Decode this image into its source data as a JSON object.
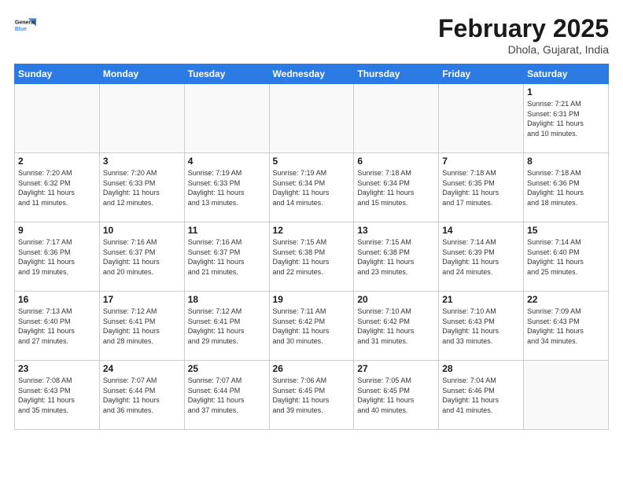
{
  "header": {
    "logo_line1": "General",
    "logo_line2": "Blue",
    "title": "February 2025",
    "subtitle": "Dhola, Gujarat, India"
  },
  "weekdays": [
    "Sunday",
    "Monday",
    "Tuesday",
    "Wednesday",
    "Thursday",
    "Friday",
    "Saturday"
  ],
  "weeks": [
    [
      {
        "num": "",
        "text": ""
      },
      {
        "num": "",
        "text": ""
      },
      {
        "num": "",
        "text": ""
      },
      {
        "num": "",
        "text": ""
      },
      {
        "num": "",
        "text": ""
      },
      {
        "num": "",
        "text": ""
      },
      {
        "num": "1",
        "text": "Sunrise: 7:21 AM\nSunset: 6:31 PM\nDaylight: 11 hours\nand 10 minutes."
      }
    ],
    [
      {
        "num": "2",
        "text": "Sunrise: 7:20 AM\nSunset: 6:32 PM\nDaylight: 11 hours\nand 11 minutes."
      },
      {
        "num": "3",
        "text": "Sunrise: 7:20 AM\nSunset: 6:33 PM\nDaylight: 11 hours\nand 12 minutes."
      },
      {
        "num": "4",
        "text": "Sunrise: 7:19 AM\nSunset: 6:33 PM\nDaylight: 11 hours\nand 13 minutes."
      },
      {
        "num": "5",
        "text": "Sunrise: 7:19 AM\nSunset: 6:34 PM\nDaylight: 11 hours\nand 14 minutes."
      },
      {
        "num": "6",
        "text": "Sunrise: 7:18 AM\nSunset: 6:34 PM\nDaylight: 11 hours\nand 15 minutes."
      },
      {
        "num": "7",
        "text": "Sunrise: 7:18 AM\nSunset: 6:35 PM\nDaylight: 11 hours\nand 17 minutes."
      },
      {
        "num": "8",
        "text": "Sunrise: 7:18 AM\nSunset: 6:36 PM\nDaylight: 11 hours\nand 18 minutes."
      }
    ],
    [
      {
        "num": "9",
        "text": "Sunrise: 7:17 AM\nSunset: 6:36 PM\nDaylight: 11 hours\nand 19 minutes."
      },
      {
        "num": "10",
        "text": "Sunrise: 7:16 AM\nSunset: 6:37 PM\nDaylight: 11 hours\nand 20 minutes."
      },
      {
        "num": "11",
        "text": "Sunrise: 7:16 AM\nSunset: 6:37 PM\nDaylight: 11 hours\nand 21 minutes."
      },
      {
        "num": "12",
        "text": "Sunrise: 7:15 AM\nSunset: 6:38 PM\nDaylight: 11 hours\nand 22 minutes."
      },
      {
        "num": "13",
        "text": "Sunrise: 7:15 AM\nSunset: 6:38 PM\nDaylight: 11 hours\nand 23 minutes."
      },
      {
        "num": "14",
        "text": "Sunrise: 7:14 AM\nSunset: 6:39 PM\nDaylight: 11 hours\nand 24 minutes."
      },
      {
        "num": "15",
        "text": "Sunrise: 7:14 AM\nSunset: 6:40 PM\nDaylight: 11 hours\nand 25 minutes."
      }
    ],
    [
      {
        "num": "16",
        "text": "Sunrise: 7:13 AM\nSunset: 6:40 PM\nDaylight: 11 hours\nand 27 minutes."
      },
      {
        "num": "17",
        "text": "Sunrise: 7:12 AM\nSunset: 6:41 PM\nDaylight: 11 hours\nand 28 minutes."
      },
      {
        "num": "18",
        "text": "Sunrise: 7:12 AM\nSunset: 6:41 PM\nDaylight: 11 hours\nand 29 minutes."
      },
      {
        "num": "19",
        "text": "Sunrise: 7:11 AM\nSunset: 6:42 PM\nDaylight: 11 hours\nand 30 minutes."
      },
      {
        "num": "20",
        "text": "Sunrise: 7:10 AM\nSunset: 6:42 PM\nDaylight: 11 hours\nand 31 minutes."
      },
      {
        "num": "21",
        "text": "Sunrise: 7:10 AM\nSunset: 6:43 PM\nDaylight: 11 hours\nand 33 minutes."
      },
      {
        "num": "22",
        "text": "Sunrise: 7:09 AM\nSunset: 6:43 PM\nDaylight: 11 hours\nand 34 minutes."
      }
    ],
    [
      {
        "num": "23",
        "text": "Sunrise: 7:08 AM\nSunset: 6:43 PM\nDaylight: 11 hours\nand 35 minutes."
      },
      {
        "num": "24",
        "text": "Sunrise: 7:07 AM\nSunset: 6:44 PM\nDaylight: 11 hours\nand 36 minutes."
      },
      {
        "num": "25",
        "text": "Sunrise: 7:07 AM\nSunset: 6:44 PM\nDaylight: 11 hours\nand 37 minutes."
      },
      {
        "num": "26",
        "text": "Sunrise: 7:06 AM\nSunset: 6:45 PM\nDaylight: 11 hours\nand 39 minutes."
      },
      {
        "num": "27",
        "text": "Sunrise: 7:05 AM\nSunset: 6:45 PM\nDaylight: 11 hours\nand 40 minutes."
      },
      {
        "num": "28",
        "text": "Sunrise: 7:04 AM\nSunset: 6:46 PM\nDaylight: 11 hours\nand 41 minutes."
      },
      {
        "num": "",
        "text": ""
      }
    ]
  ]
}
